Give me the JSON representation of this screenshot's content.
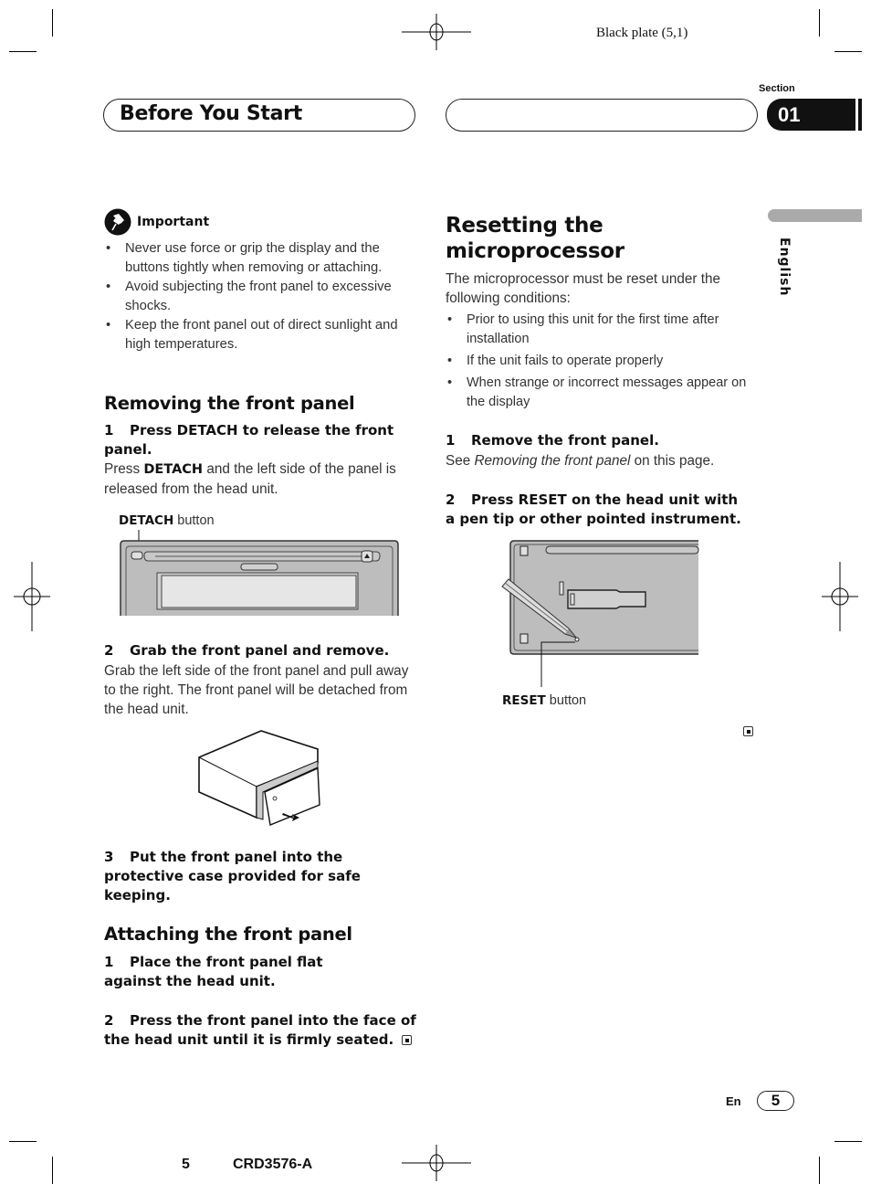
{
  "print_marks": {
    "plate_label": "Black plate (5,1)",
    "footer_page": "5",
    "footer_code": "CRD3576-A"
  },
  "header": {
    "title": "Before You Start",
    "section_label": "Section",
    "section_number": "01"
  },
  "side_tab": {
    "language": "English"
  },
  "important": {
    "icon": "pushpin-icon",
    "label": "Important",
    "bullets": [
      "Never use force or grip the display and the buttons tightly when removing or attaching.",
      "Avoid subjecting the front panel to excessive shocks.",
      "Keep the front panel out of direct sunlight and high temperatures."
    ]
  },
  "removing": {
    "heading": "Removing the front panel",
    "step1": {
      "num": "1",
      "title": "Press DETACH to release the front panel.",
      "body_pre": "Press ",
      "body_bold": "DETACH",
      "body_post": " and the left side of the panel is released from the head unit."
    },
    "figure1_caption_bold": "DETACH",
    "figure1_caption_rest": " button",
    "step2": {
      "num": "2",
      "title": "Grab the front panel and remove.",
      "body": "Grab the left side of the front panel and pull away to the right. The front panel will be detached from the head unit."
    },
    "step3": {
      "num": "3",
      "title": "Put the front panel into the protective case provided for safe keeping."
    }
  },
  "attaching": {
    "heading": "Attaching the front panel",
    "step1": {
      "num": "1",
      "title": "Place the front panel flat against the head unit."
    },
    "step2": {
      "num": "2",
      "title": "Press the front panel into the face of the head unit until it is firmly seated."
    }
  },
  "resetting": {
    "heading_line1": "Resetting the",
    "heading_line2": "microprocessor",
    "intro": "The microprocessor must be reset under the following conditions:",
    "bullets": [
      "Prior to using this unit for the first time after installation",
      "If the unit fails to operate properly",
      "When strange or incorrect messages appear on the display"
    ],
    "step1": {
      "num": "1",
      "title": "Remove the front panel.",
      "body_pre": "See ",
      "body_italic": "Removing the front panel",
      "body_post": " on this page."
    },
    "step2": {
      "num": "2",
      "title": "Press RESET on the head unit with a pen tip or other pointed instrument."
    },
    "figure_caption_bold": "RESET",
    "figure_caption_rest": " button"
  },
  "footer": {
    "lang_code": "En",
    "page_number": "5"
  }
}
